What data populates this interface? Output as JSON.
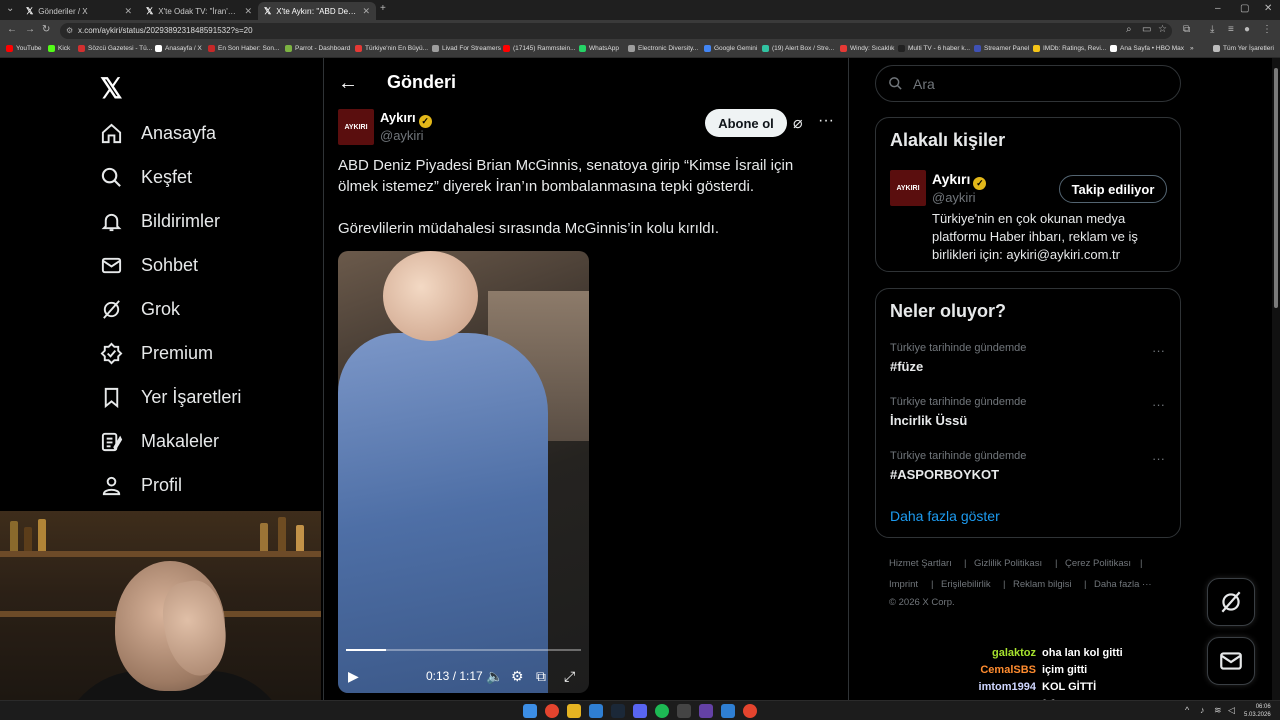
{
  "browser": {
    "tabs": [
      {
        "title": "Gönderiler / X",
        "active": false
      },
      {
        "title": "X'te Odak TV: \"İran'a açıktan t...",
        "active": false
      },
      {
        "title": "X'te Aykırı: \"ABD Deniz Piyade...",
        "active": true
      }
    ],
    "url": "x.com/aykiri/status/2029389231848591532?s=20",
    "bookmarks": [
      {
        "label": "YouTube",
        "color": "#ff0000"
      },
      {
        "label": "Kick",
        "color": "#53fc18"
      },
      {
        "label": "Sözcü Gazetesi - Tü...",
        "color": "#d32f2f"
      },
      {
        "label": "Anasayfa / X",
        "color": "#ffffff"
      },
      {
        "label": "En Son Haber: Son...",
        "color": "#c62828"
      },
      {
        "label": "Parrot - Dashboard",
        "color": "#7cb342"
      },
      {
        "label": "Türkiye'nin En Büyü...",
        "color": "#e53935"
      },
      {
        "label": "Livad For Streamers",
        "color": "#9e9e9e"
      },
      {
        "label": "(17145) Rammstein...",
        "color": "#ff0000"
      },
      {
        "label": "WhatsApp",
        "color": "#25d366"
      },
      {
        "label": "Electronic Diversity...",
        "color": "#9e9e9e"
      },
      {
        "label": "Google Gemini",
        "color": "#4285f4"
      },
      {
        "label": "(19) Alert Box / Stre...",
        "color": "#31c3a2"
      },
      {
        "label": "Windy: Sıcaklık",
        "color": "#e53935"
      },
      {
        "label": "Multi TV - 6 haber k...",
        "color": "#212121"
      },
      {
        "label": "Streamer Panel",
        "color": "#3f51b5"
      },
      {
        "label": "IMDb: Ratings, Revi...",
        "color": "#f5c518"
      },
      {
        "label": "Ana Sayfa • HBO Max",
        "color": "#ffffff"
      }
    ],
    "bookmarks_all": "Tüm Yer İşaretleri"
  },
  "sidebar": {
    "items": [
      {
        "label": "Anasayfa",
        "icon": "home-icon"
      },
      {
        "label": "Keşfet",
        "icon": "search-icon"
      },
      {
        "label": "Bildirimler",
        "icon": "bell-icon"
      },
      {
        "label": "Sohbet",
        "icon": "mail-icon"
      },
      {
        "label": "Grok",
        "icon": "grok-icon"
      },
      {
        "label": "Premium",
        "icon": "verified-icon"
      },
      {
        "label": "Yer İşaretleri",
        "icon": "bookmark-icon"
      },
      {
        "label": "Makaleler",
        "icon": "article-icon"
      },
      {
        "label": "Profil",
        "icon": "profile-icon"
      }
    ]
  },
  "header": {
    "title": "Gönderi"
  },
  "post": {
    "author_name": "Aykırı",
    "author_handle": "@aykiri",
    "avatar_text": "AYKIRI",
    "subscribe_label": "Abone ol",
    "lines": [
      "ABD Deniz Piyadesi Brian McGinnis, senatoya girip “Kimse İsrail için",
      "ölmek istemez” diyerek İran’ın bombalanmasına tepki gösterdi.",
      "Görevlilerin müdahalesi sırasında McGinnis’in kolu kırıldı."
    ],
    "video": {
      "time": "0:13 / 1:17",
      "progress": 0.169
    }
  },
  "right": {
    "search_placeholder": "Ara",
    "related": {
      "title": "Alakalı kişiler",
      "name": "Aykırı",
      "handle": "@aykiri",
      "avatar_text": "AYKIRI",
      "follow_label": "Takip ediliyor",
      "bio": [
        "Türkiye'nin en çok okunan medya",
        "platformu Haber ihbarı, reklam ve iş",
        "birlikleri için: aykiri@aykiri.com.tr"
      ]
    },
    "trends": {
      "title": "Neler oluyor?",
      "items": [
        {
          "context": "Türkiye tarihinde gündemde",
          "name": "#füze"
        },
        {
          "context": "Türkiye tarihinde gündemde",
          "name": "İncirlik Üssü"
        },
        {
          "context": "Türkiye tarihinde gündemde",
          "name": "#ASPORBOYKOT"
        }
      ],
      "show_more": "Daha fazla göster"
    },
    "footer": {
      "links": [
        "Hizmet Şartları",
        "Gizlilik Politikası",
        "Çerez Politikası",
        "Imprint",
        "Erişilebilirlik",
        "Reklam bilgisi",
        "Daha fazla ···"
      ],
      "copyright": "© 2026 X Corp."
    }
  },
  "chat": [
    {
      "user": "galaktoz",
      "message": "oha lan kol gitti",
      "color": "#a6e22e"
    },
    {
      "user": "CemalSBS",
      "message": "içim gitti",
      "color": "#ff8c2f"
    },
    {
      "user": "imtom1994",
      "message": "KOL GİTTİ",
      "color": "#cfd6ff"
    },
    {
      "user": "imtom1994",
      "message": "",
      "color": "#cfd6ff"
    }
  ],
  "taskbar": {
    "time": "06:06",
    "date": "5.03.2026"
  }
}
